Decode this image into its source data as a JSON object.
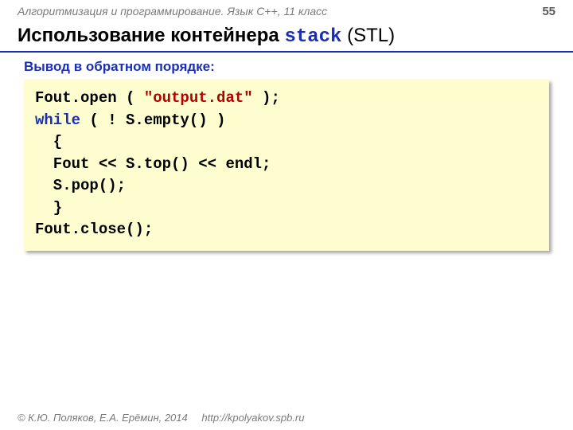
{
  "header": {
    "course": "Алгоритмизация и программирование. Язык C++, 11 класс",
    "page": "55"
  },
  "title": {
    "pre": "Использование контейнера ",
    "mono": "stack",
    "post": " (STL)"
  },
  "subhead": "Вывод в обратном порядке:",
  "code": {
    "l1a": "Fout.open ( ",
    "l1s": "\"output.dat\"",
    "l1b": " );",
    "l2k": "while",
    "l2a": " ( ! S.empty() )",
    "l3": "  {",
    "l4": "  Fout << S.top() << endl;",
    "l5": "  S.pop();",
    "l6": "  }",
    "l7": "Fout.close();"
  },
  "footer": {
    "copyright": "© К.Ю. Поляков, Е.А. Ерёмин, 2014",
    "url": "http://kpolyakov.spb.ru"
  }
}
